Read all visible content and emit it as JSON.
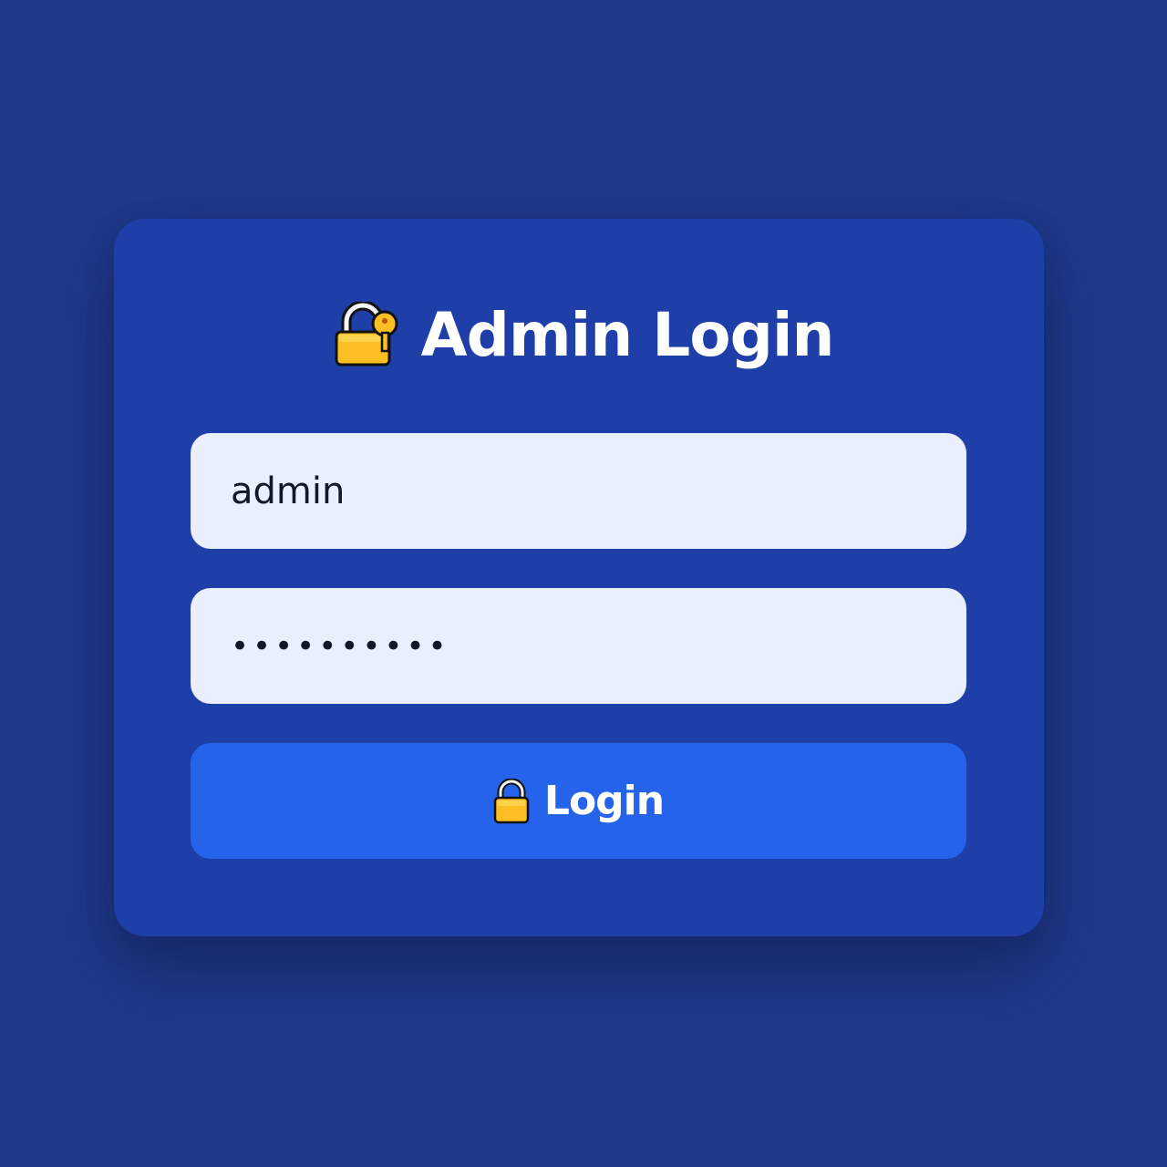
{
  "colors": {
    "background": "#1f3a8a",
    "card": "#1e3ea8",
    "input_bg": "#e9effc",
    "button": "#2563eb",
    "lock_body": "#fbbf24"
  },
  "header": {
    "icon": "lock-with-key-icon",
    "title": "Admin Login"
  },
  "form": {
    "username": {
      "value": "admin"
    },
    "password": {
      "value": "••••••••••"
    },
    "submit": {
      "icon": "lock-icon",
      "label": "Login"
    }
  }
}
